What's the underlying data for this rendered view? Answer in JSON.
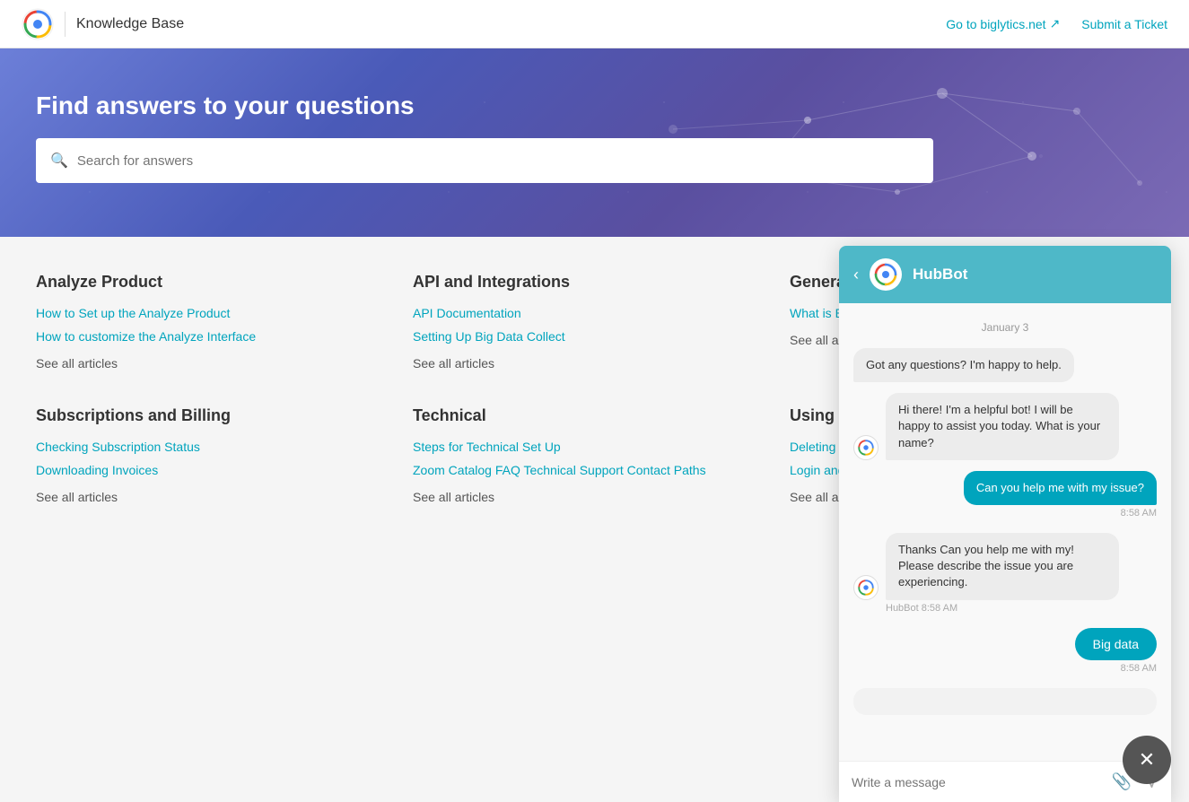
{
  "header": {
    "title": "Knowledge Base",
    "nav_link_1": "Go to biglytics.net",
    "nav_link_2": "Submit a Ticket"
  },
  "hero": {
    "title": "Find answers to your questions",
    "search_placeholder": "Search for answers"
  },
  "categories": [
    {
      "id": "analyze-product",
      "title": "Analyze Product",
      "links": [
        "How to Set up the Analyze Product",
        "How to customize the Analyze Interface"
      ],
      "see_all": "See all articles"
    },
    {
      "id": "api-integrations",
      "title": "API and Integrations",
      "links": [
        "API Documentation",
        "Setting Up Big Data Collect"
      ],
      "see_all": "See all articles"
    },
    {
      "id": "general-questions",
      "title": "General Questions",
      "links": [
        "What is Big Data?"
      ],
      "see_all": "See all articles"
    },
    {
      "id": "subscriptions-billing",
      "title": "Subscriptions and Billing",
      "links": [
        "Checking Subscription Status",
        "Downloading Invoices"
      ],
      "see_all": "See all articles"
    },
    {
      "id": "technical",
      "title": "Technical",
      "links": [
        "Steps for Technical Set Up",
        "Zoom Catalog FAQ Technical Support Contact Paths"
      ],
      "see_all": "See all articles"
    },
    {
      "id": "using-biglytics",
      "title": "Using Biglytics",
      "links": [
        "Deleting Biglytics Account",
        "Login and Password Recovery"
      ],
      "see_all": "See all articles"
    }
  ],
  "chat": {
    "bot_name": "HubBot",
    "date_label": "January 3",
    "messages": [
      {
        "type": "bot",
        "text": "Got any questions? I'm happy to help."
      },
      {
        "type": "bot",
        "text": "Hi there! I'm a helpful bot! I will be happy to assist you today. What is your name?"
      },
      {
        "type": "user",
        "text": "Can you help me with my issue?",
        "time": "8:58 AM"
      },
      {
        "type": "bot",
        "text": "Thanks Can you help me with my! Please describe the issue you are experiencing.",
        "sender": "HubBot",
        "time": "8:58 AM"
      },
      {
        "type": "user_button",
        "text": "Big data",
        "time": "8:58 AM"
      }
    ],
    "input_placeholder": "Write a message",
    "back_label": "‹",
    "close_label": "✕"
  }
}
